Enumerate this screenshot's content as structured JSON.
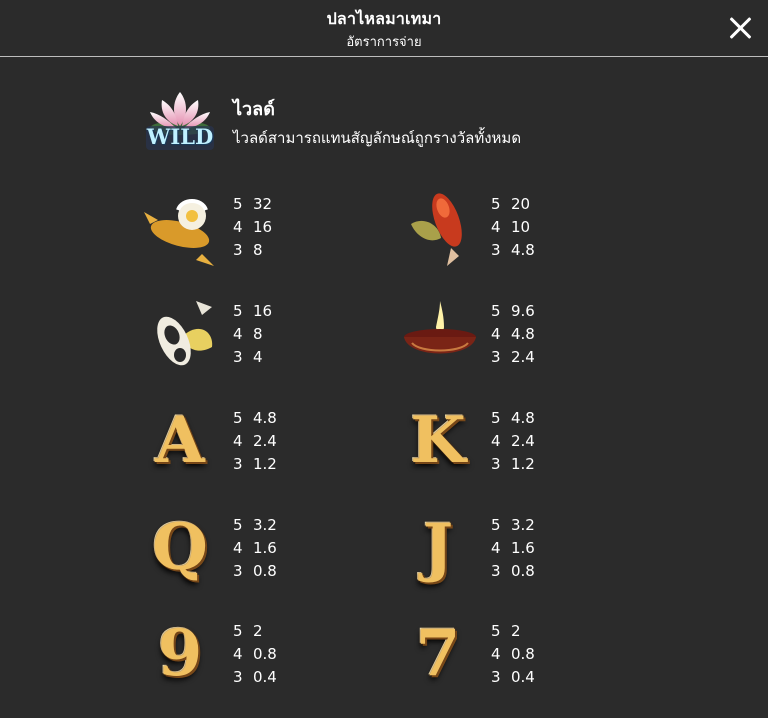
{
  "header": {
    "title": "ปลาไหลมาเทมา",
    "subtitle": "อัตราการจ่าย"
  },
  "wild": {
    "label": "WILD",
    "title": "ไวลด์",
    "description": "ไวลด์สามารถแทนสัญลักษณ์ถูกรางวัลทั้งหมด"
  },
  "symbols": [
    {
      "icon": "golden-koi-lotus-icon",
      "pays": [
        {
          "count": "5",
          "value": "32"
        },
        {
          "count": "4",
          "value": "16"
        },
        {
          "count": "3",
          "value": "8"
        }
      ]
    },
    {
      "icon": "red-koi-icon",
      "pays": [
        {
          "count": "5",
          "value": "20"
        },
        {
          "count": "4",
          "value": "10"
        },
        {
          "count": "3",
          "value": "4.8"
        }
      ]
    },
    {
      "icon": "black-white-koi-icon",
      "pays": [
        {
          "count": "5",
          "value": "16"
        },
        {
          "count": "4",
          "value": "8"
        },
        {
          "count": "3",
          "value": "4"
        }
      ]
    },
    {
      "icon": "oil-lamp-icon",
      "pays": [
        {
          "count": "5",
          "value": "9.6"
        },
        {
          "count": "4",
          "value": "4.8"
        },
        {
          "count": "3",
          "value": "2.4"
        }
      ]
    },
    {
      "icon": "letter-a-icon",
      "letter": "A",
      "pays": [
        {
          "count": "5",
          "value": "4.8"
        },
        {
          "count": "4",
          "value": "2.4"
        },
        {
          "count": "3",
          "value": "1.2"
        }
      ]
    },
    {
      "icon": "letter-k-icon",
      "letter": "K",
      "pays": [
        {
          "count": "5",
          "value": "4.8"
        },
        {
          "count": "4",
          "value": "2.4"
        },
        {
          "count": "3",
          "value": "1.2"
        }
      ]
    },
    {
      "icon": "letter-q-icon",
      "letter": "Q",
      "pays": [
        {
          "count": "5",
          "value": "3.2"
        },
        {
          "count": "4",
          "value": "1.6"
        },
        {
          "count": "3",
          "value": "0.8"
        }
      ]
    },
    {
      "icon": "letter-j-icon",
      "letter": "J",
      "pays": [
        {
          "count": "5",
          "value": "3.2"
        },
        {
          "count": "4",
          "value": "1.6"
        },
        {
          "count": "3",
          "value": "0.8"
        }
      ]
    },
    {
      "icon": "number-9-icon",
      "letter": "9",
      "pays": [
        {
          "count": "5",
          "value": "2"
        },
        {
          "count": "4",
          "value": "0.8"
        },
        {
          "count": "3",
          "value": "0.4"
        }
      ]
    },
    {
      "icon": "number-7-icon",
      "letter": "7",
      "pays": [
        {
          "count": "5",
          "value": "2"
        },
        {
          "count": "4",
          "value": "0.8"
        },
        {
          "count": "3",
          "value": "0.4"
        }
      ]
    }
  ]
}
